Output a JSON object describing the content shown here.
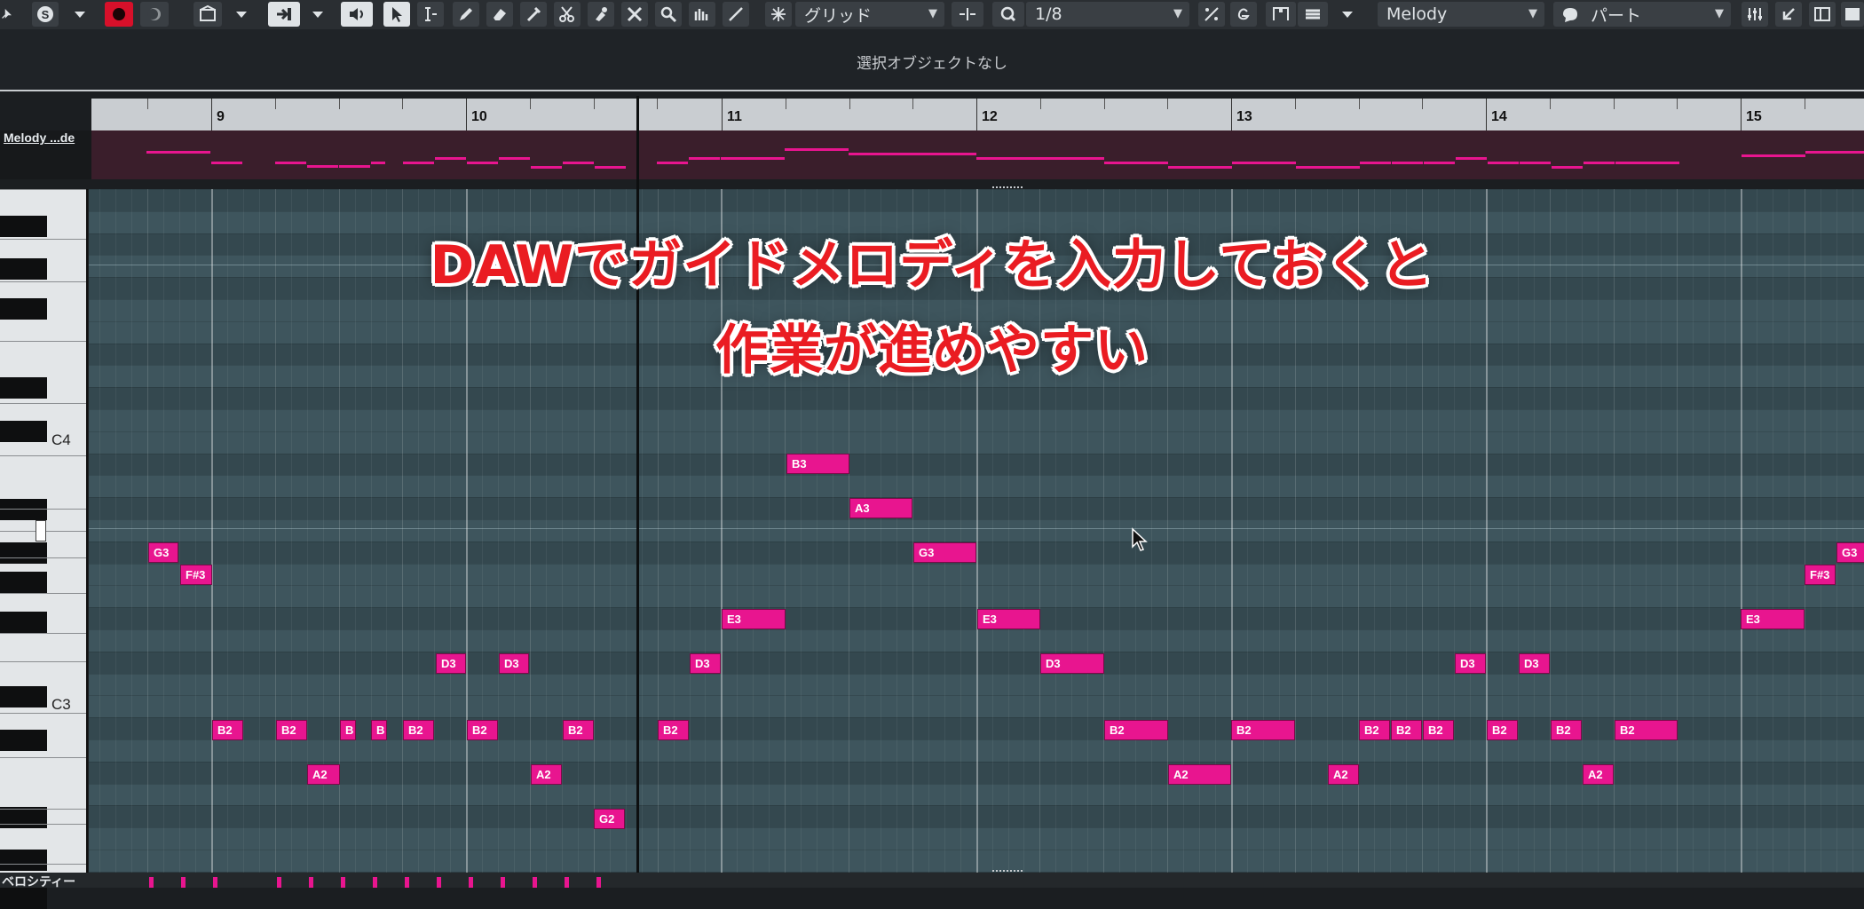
{
  "toolbar": {
    "quantize_mode": "グリッド",
    "quantize_value": "1/8",
    "track_select": "Melody",
    "part_select": "パート",
    "icons": [
      "solo-icon",
      "record-icon",
      "monitor-icon",
      "window-icon",
      "route-icon",
      "speaker-icon",
      "pointer-icon",
      "range-icon",
      "pencil-icon",
      "eraser-icon",
      "paint-icon",
      "scissors-icon",
      "glue-icon",
      "mute-icon",
      "zoom-icon",
      "drumstick-icon",
      "line-icon",
      "snap-icon",
      "quantize-icon",
      "pitch-icon",
      "legato-icon",
      "lane-icon",
      "mixer-icon",
      "expand-icon",
      "layout-icon"
    ],
    "accent_record": "#e0102b"
  },
  "info_line": "選択オブジェクトなし",
  "ruler": {
    "bars": [
      "9",
      "10",
      "11",
      "12",
      "13",
      "14",
      "15"
    ]
  },
  "track_name": "Melody ...de",
  "keyboard": {
    "labels": [
      "C4",
      "C3"
    ]
  },
  "overlay": {
    "line1": "DAWでガイドメロディを入力しておくと",
    "line2": "作業が進めやすい"
  },
  "notes": [
    {
      "label": "G3"
    },
    {
      "label": "F#3"
    },
    {
      "label": "B2"
    },
    {
      "label": "B2"
    },
    {
      "label": "A2"
    },
    {
      "label": "B"
    },
    {
      "label": "B"
    },
    {
      "label": "B2"
    },
    {
      "label": "D3"
    },
    {
      "label": "B2"
    },
    {
      "label": "D3"
    },
    {
      "label": "A2"
    },
    {
      "label": "B2"
    },
    {
      "label": "G2"
    },
    {
      "label": "B2"
    },
    {
      "label": "D3"
    },
    {
      "label": "E3"
    },
    {
      "label": "B3"
    },
    {
      "label": "A3"
    },
    {
      "label": "G3"
    },
    {
      "label": "E3"
    },
    {
      "label": "D3"
    },
    {
      "label": "B2"
    },
    {
      "label": "A2"
    },
    {
      "label": "B2"
    },
    {
      "label": "A2"
    },
    {
      "label": "B2"
    },
    {
      "label": "B2"
    },
    {
      "label": "B2"
    },
    {
      "label": "D3"
    },
    {
      "label": "B2"
    },
    {
      "label": "D3"
    },
    {
      "label": "B2"
    },
    {
      "label": "A2"
    },
    {
      "label": "B2"
    },
    {
      "label": "E3"
    },
    {
      "label": "F#3"
    },
    {
      "label": "G3"
    }
  ],
  "velocity_label": "ベロシティー",
  "colors": {
    "note": "#e8158f",
    "grid_bg": "#3b5159",
    "overlay_text": "#ea1c22"
  }
}
